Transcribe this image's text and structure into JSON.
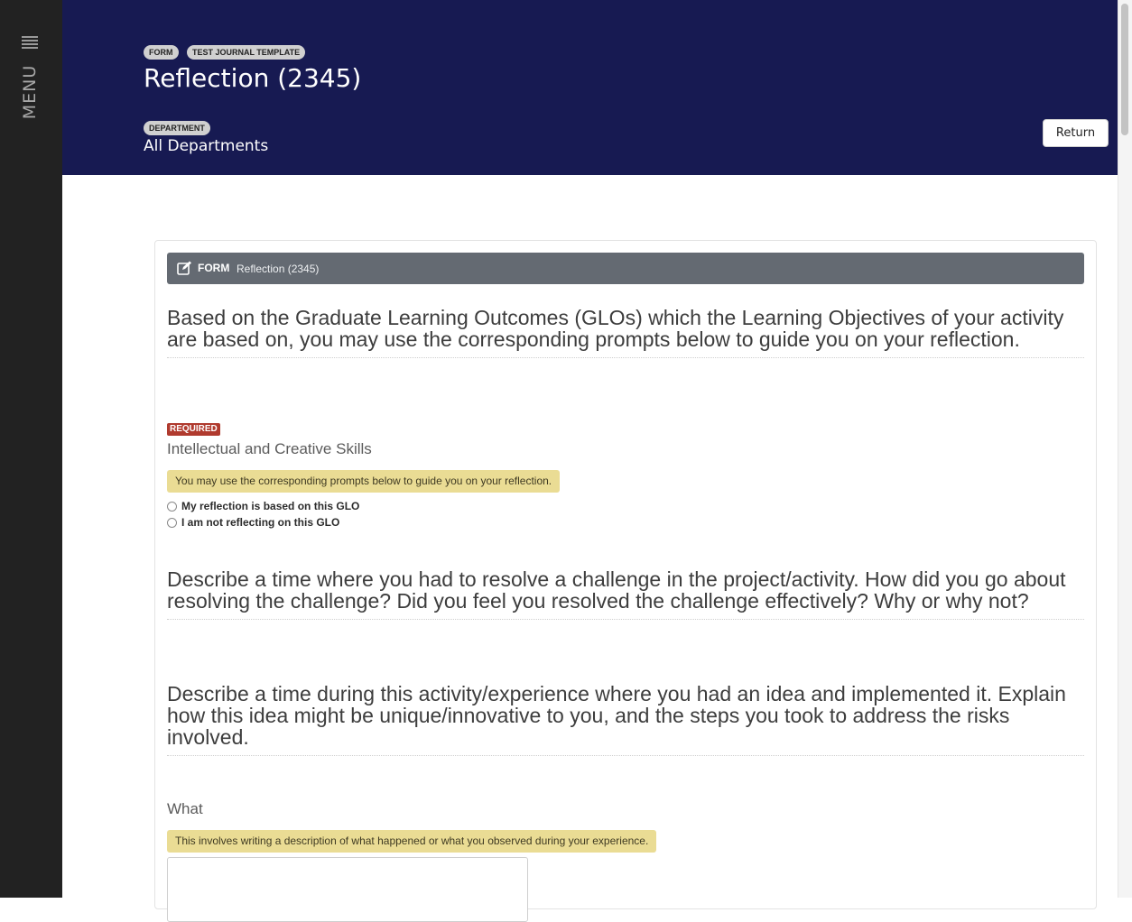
{
  "sidebar": {
    "menu_label": "MENU",
    "menu_icon": "hamburger-icon"
  },
  "header": {
    "tags": [
      "FORM",
      "TEST JOURNAL TEMPLATE"
    ],
    "title": "Reflection (2345)",
    "department_label": "DEPARTMENT",
    "department_value": "All Departments",
    "return_label": "Return"
  },
  "form": {
    "bar_icon": "edit-icon",
    "bar_kind": "FORM",
    "bar_name": "Reflection (2345)",
    "intro": "Based on the Graduate Learning Outcomes (GLOs) which the Learning Objectives of your activity are based on, you may use the corresponding prompts below to guide you on your reflection.",
    "glo": {
      "required_badge": "REQUIRED",
      "label": "Intellectual and Creative Skills",
      "hint": "You may use the corresponding prompts below to guide you on your reflection.",
      "options": [
        "My reflection is based on this GLO",
        "I am not reflecting on this GLO"
      ]
    },
    "prompt1": "Describe a time where you had to resolve a challenge in the project/activity. How did you go about resolving the challenge? Did you feel you resolved the challenge effectively? Why or why not?",
    "prompt2": "Describe a time during this activity/experience where you had an idea and implemented it. Explain how this idea might be unique/innovative to you, and the steps you took to address the risks involved.",
    "what": {
      "label": "What",
      "hint": "This involves writing a description of what happened or what you observed during your experience.",
      "value": ""
    }
  },
  "colors": {
    "header_bg": "#171a52",
    "rail_bg": "#222222",
    "form_bar_bg": "#646a72",
    "hint_bg": "#eadc94",
    "required_bg": "#b03a2e"
  }
}
